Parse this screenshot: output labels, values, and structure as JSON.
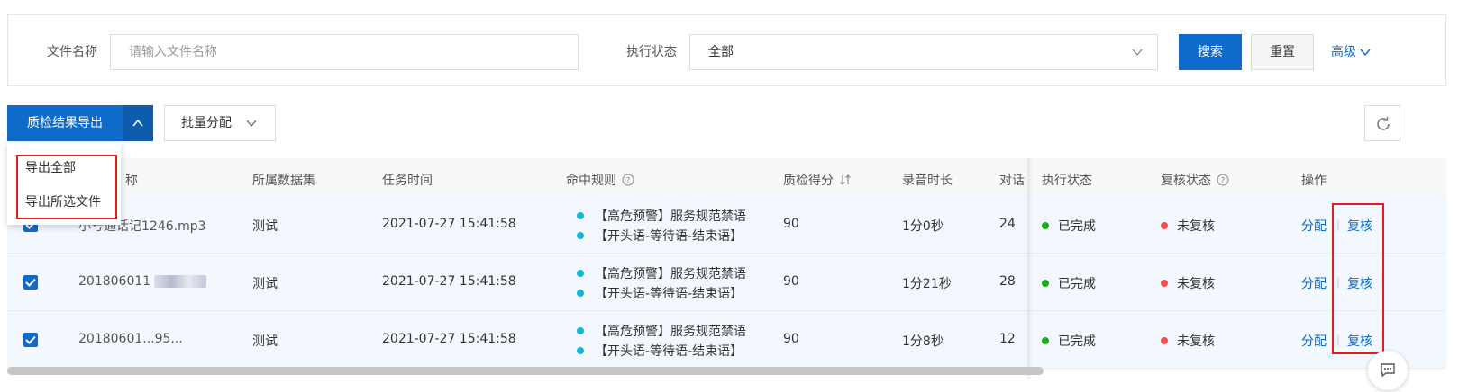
{
  "filter": {
    "file_name_label": "文件名称",
    "file_name_placeholder": "请输入文件名称",
    "status_label": "执行状态",
    "status_value": "全部",
    "search_label": "搜索",
    "reset_label": "重置",
    "advanced_label": "高级"
  },
  "toolbar": {
    "export_label": "质检结果导出",
    "batch_label": "批量分配"
  },
  "dropdown": {
    "items": [
      "导出全部",
      "导出所选文件"
    ]
  },
  "table": {
    "headers": {
      "name": "称",
      "dataset": "所属数据集",
      "task_time": "任务时间",
      "rules": "命中规则",
      "score": "质检得分",
      "duration": "录音时长",
      "dialog": "对话",
      "exec_status": "执行状态",
      "review_status": "复核状态",
      "action": "操作"
    },
    "rows": [
      {
        "name": "小号通话记1246.mp3",
        "dataset": "测试",
        "task_time": "2021-07-27 15:41:58",
        "rule1": "【高危预警】服务规范禁语",
        "rule2": "【开头语-等待语-结束语】",
        "score": "90",
        "duration": "1分0秒",
        "dialog": "24",
        "exec_status": "已完成",
        "review_status": "未复核",
        "assign": "分配",
        "review": "复核"
      },
      {
        "name": "201806011",
        "dataset": "测试",
        "task_time": "2021-07-27 15:41:58",
        "rule1": "【高危预警】服务规范禁语",
        "rule2": "【开头语-等待语-结束语】",
        "score": "90",
        "duration": "1分21秒",
        "dialog": "28",
        "exec_status": "已完成",
        "review_status": "未复核",
        "assign": "分配",
        "review": "复核"
      },
      {
        "name": "20180601...95...",
        "dataset": "测试",
        "task_time": "2021-07-27 15:41:58",
        "rule1": "【高危预警】服务规范禁语",
        "rule2": "【开头语-等待语-结束语】",
        "score": "90",
        "duration": "1分8秒",
        "dialog": "12",
        "exec_status": "已完成",
        "review_status": "未复核",
        "assign": "分配",
        "review": "复核"
      }
    ]
  },
  "colors": {
    "primary": "#0f6bc9",
    "success": "#1aad19",
    "danger": "#f24c4c",
    "rule_dot": "#13b4d8",
    "highlight": "#e11d1d"
  },
  "icons": [
    "chevron-down-icon",
    "chevron-up-icon",
    "refresh-icon",
    "help-icon",
    "sort-icon",
    "check-icon",
    "chat-icon"
  ]
}
